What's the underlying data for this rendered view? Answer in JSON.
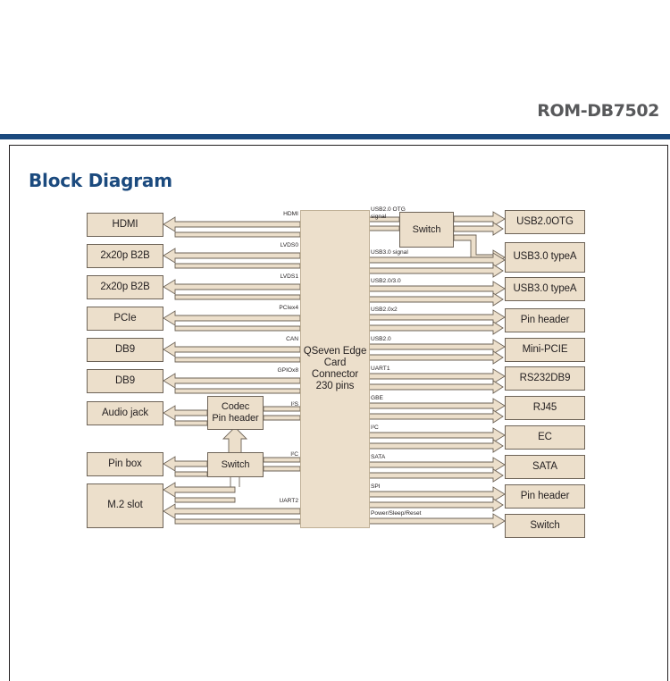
{
  "header": {
    "doc_title": "ROM-DB7502",
    "rule_color": "#1b4a7e"
  },
  "section": {
    "title": "Block Diagram",
    "title_color": "#1b4a7e"
  },
  "palette": {
    "box_fill": "#ecdfcb",
    "box_stroke": "#6d6357",
    "arrow_fill": "#ecdfcb",
    "arrow_stroke": "#6d6357",
    "text": "#231f20"
  },
  "diagram": {
    "center": {
      "label_line1": "QSeven Edge",
      "label_line2": "Card Connector",
      "label_line3": "230 pins"
    },
    "left_boxes": [
      {
        "label": "HDMI",
        "signal": "HDMI"
      },
      {
        "label": "2x20p B2B",
        "signal": "LVDS0"
      },
      {
        "label": "2x20p B2B",
        "signal": "LVDS1"
      },
      {
        "label": "PCIe",
        "signal": "PCIex4"
      },
      {
        "label": "DB9",
        "signal": "CAN"
      },
      {
        "label": "DB9",
        "signal": "GPIOx8"
      },
      {
        "label": "Audio jack",
        "signal": "I²S"
      },
      {
        "label": "Pin box",
        "signal": "I²C"
      },
      {
        "label": "M.2 slot",
        "signal": "UART2"
      }
    ],
    "left_mid_boxes": [
      {
        "label_line1": "Codec",
        "label_line2": "Pin header"
      },
      {
        "label_line1": "Switch",
        "label_line2": ""
      }
    ],
    "right_mid_boxes": [
      {
        "label": "Switch"
      }
    ],
    "right_boxes": [
      {
        "label": "USB2.0OTG",
        "signal_line1": "USB2.0 OTG",
        "signal_line2": "signal"
      },
      {
        "label": "USB3.0 typeA",
        "signal_line1": "USB3.0 signal",
        "signal_line2": ""
      },
      {
        "label": "USB3.0 typeA",
        "signal_line1": "USB2.0/3.0",
        "signal_line2": ""
      },
      {
        "label": "Pin header",
        "signal_line1": "USB2.0x2",
        "signal_line2": ""
      },
      {
        "label": "Mini-PCIE",
        "signal_line1": "USB2.0",
        "signal_line2": ""
      },
      {
        "label": "RS232DB9",
        "signal_line1": "UART1",
        "signal_line2": ""
      },
      {
        "label": "RJ45",
        "signal_line1": "GBE",
        "signal_line2": ""
      },
      {
        "label": "EC",
        "signal_line1": "I²C",
        "signal_line2": ""
      },
      {
        "label": "SATA",
        "signal_line1": "SATA",
        "signal_line2": ""
      },
      {
        "label": "Pin header",
        "signal_line1": "SPI",
        "signal_line2": ""
      },
      {
        "label": "Switch",
        "signal_line1": "Power/Sleep/Reset",
        "signal_line2": ""
      }
    ]
  }
}
